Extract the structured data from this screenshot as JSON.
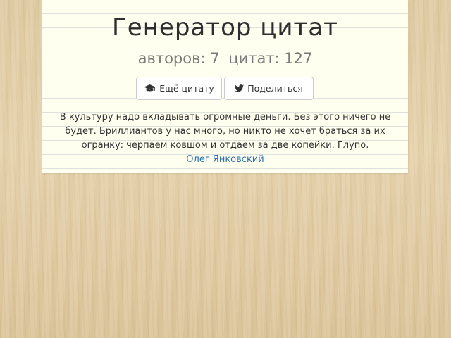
{
  "header": {
    "title": "Генератор цитат",
    "authors_text": "авторов: 7",
    "quotes_text": "цитат: 127"
  },
  "actions": {
    "more_label": "Ещё цитату",
    "more_icon": "graduation-cap-icon",
    "share_label": "Поделиться",
    "share_icon": "twitter-bird-icon"
  },
  "quote": {
    "text": "В культуру надо вкладывать огромные деньги. Без этого ничего не будет. Бриллиантов у нас много, но никто не хочет браться за их огранку: черпаем ковшом и отдаем за две копейки. Глупо.",
    "author": "Олег Янковский"
  },
  "colors": {
    "paper": "#ffffef",
    "rule_line": "#dde3dc",
    "link": "#2a6fb0",
    "background_wood": "#e3cfa6"
  }
}
